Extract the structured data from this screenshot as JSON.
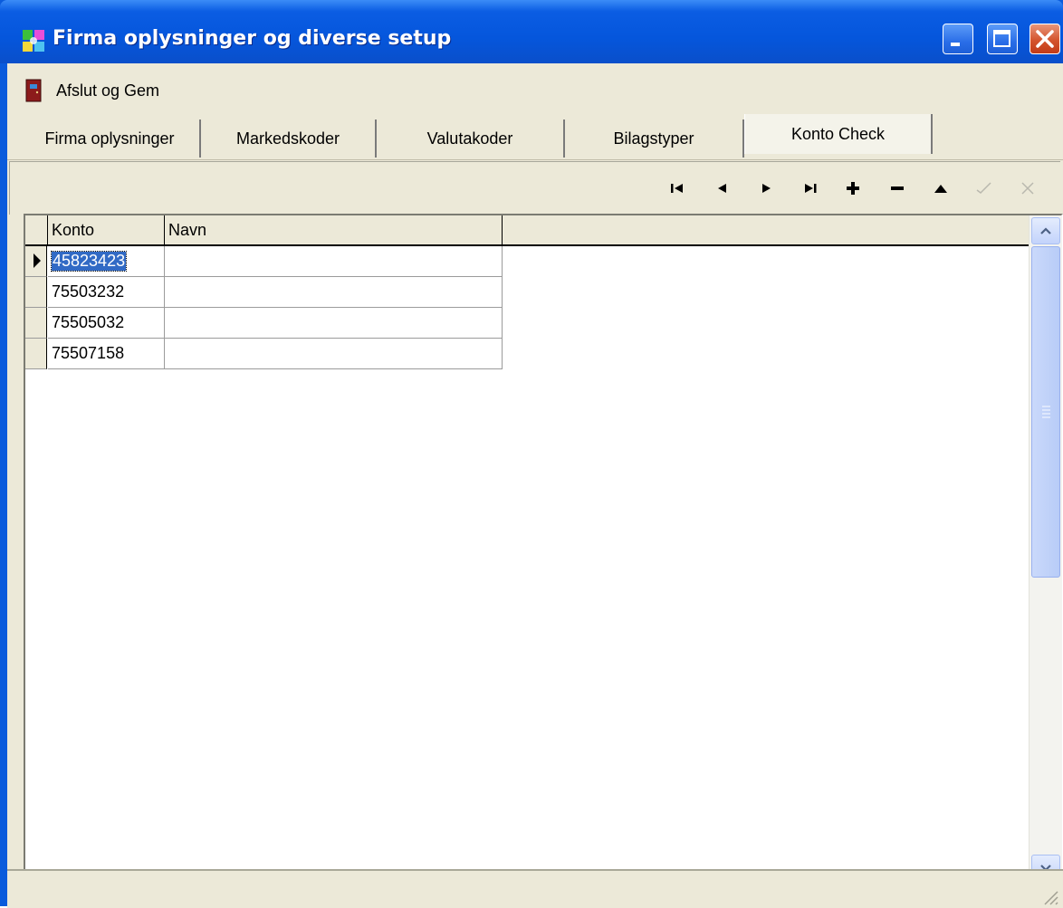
{
  "window": {
    "title": "Firma oplysninger og diverse setup",
    "icon": "app-grid-icon",
    "controls": [
      "minimize-icon",
      "maximize-icon",
      "close-icon"
    ],
    "accent": "#0a5bdc"
  },
  "menu": {
    "exit_save_label": "Afslut og Gem",
    "exit_icon": "door-icon"
  },
  "tabs": [
    {
      "label": "Firma oplysninger",
      "active": false
    },
    {
      "label": "Markedskoder",
      "active": false
    },
    {
      "label": "Valutakoder",
      "active": false
    },
    {
      "label": "Bilagstyper",
      "active": false
    },
    {
      "label": "Konto Check",
      "active": true
    }
  ],
  "navigator": [
    "first-record-icon",
    "prior-record-icon",
    "next-record-icon",
    "last-record-icon",
    "insert-icon",
    "delete-icon",
    "edit-icon",
    "post-icon",
    "cancel-icon"
  ],
  "grid": {
    "columns": [
      "Konto",
      "Navn"
    ],
    "rows": [
      {
        "konto": "45823423",
        "navn": "",
        "current": true
      },
      {
        "konto": "75503232",
        "navn": "",
        "current": false
      },
      {
        "konto": "75505032",
        "navn": "",
        "current": false
      },
      {
        "konto": "75507158",
        "navn": "",
        "current": false
      }
    ],
    "selection_color": "#316ac5"
  }
}
